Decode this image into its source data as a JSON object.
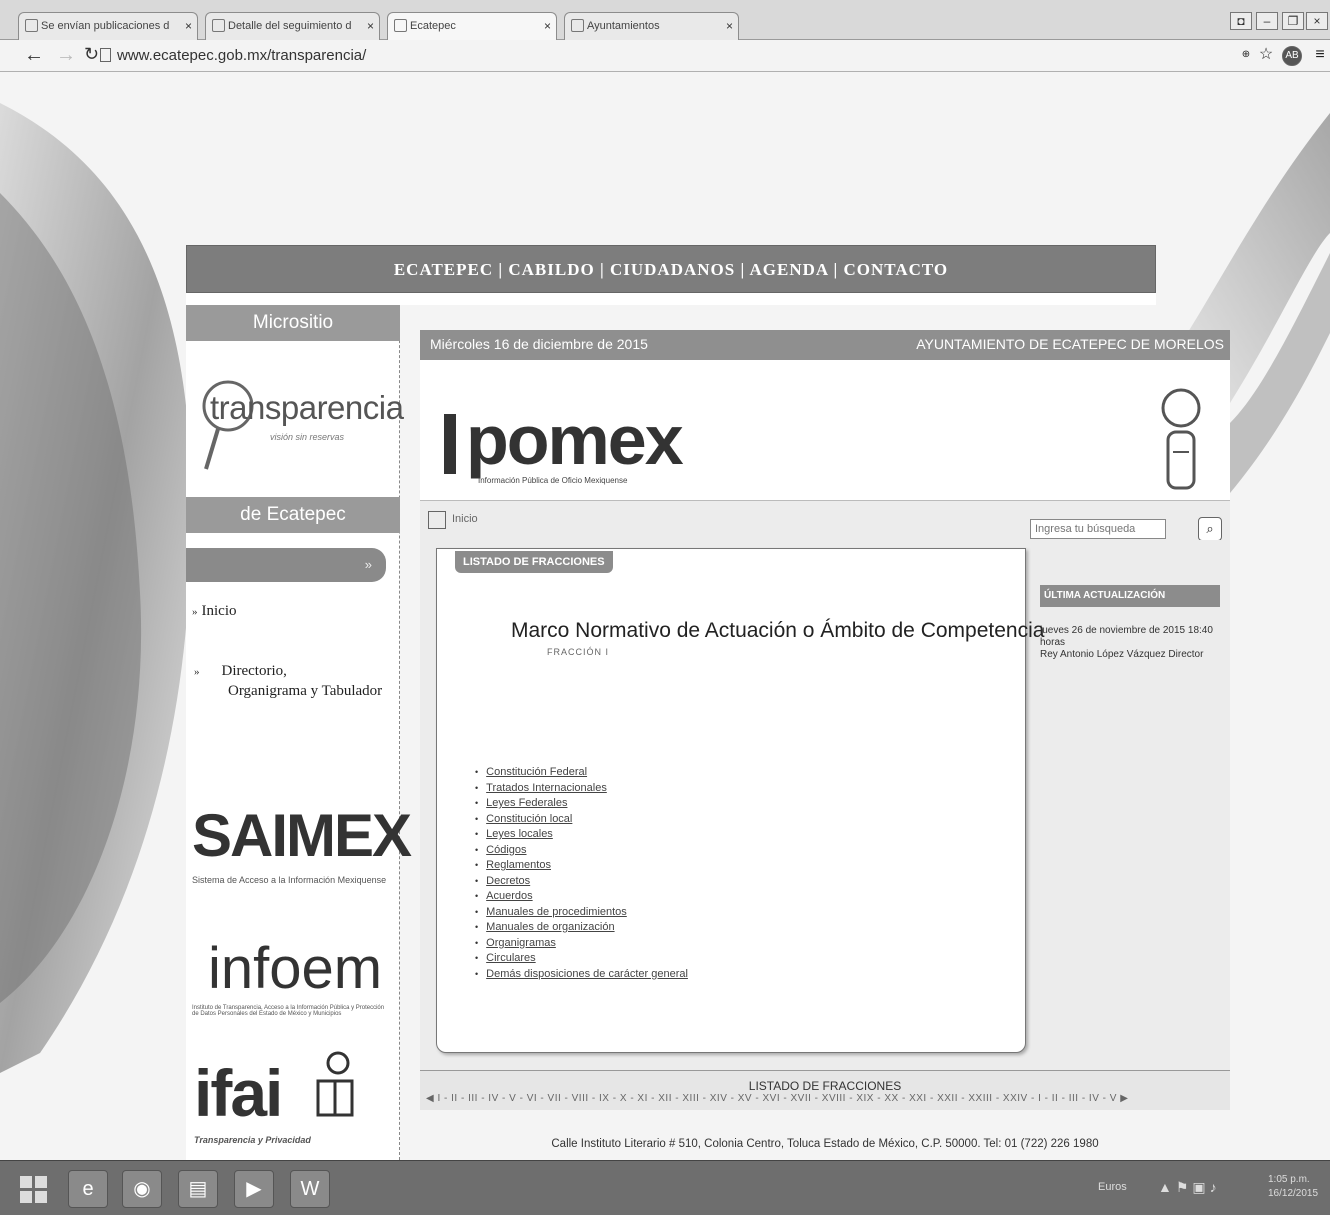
{
  "browser": {
    "tabs": [
      {
        "label": "Se envían publicaciones d",
        "active": false
      },
      {
        "label": "Detalle del seguimiento d",
        "active": false
      },
      {
        "label": "Ecatepec",
        "active": true
      },
      {
        "label": "Ayuntamientos",
        "active": false
      }
    ],
    "url": "www.ecatepec.gob.mx/transparencia/"
  },
  "site": {
    "top_nav": "ECATEPEC | CABILDO | CIUDADANOS | AGENDA | CONTACTO",
    "sidebar": {
      "title_top": "Micrositio",
      "logo_word": "transparencia",
      "logo_sub": "visión sin reservas",
      "title_bottom": "de Ecatepec",
      "menu": {
        "inicio": "Inicio",
        "directorio": "Directorio,",
        "organigrama": "Organigrama y Tabulador"
      },
      "saimex": {
        "name": "SAIMEX",
        "caption": "Sistema de Acceso a la Información Mexiquense"
      },
      "infoem": {
        "name": "infoem",
        "caption": "Instituto de Transparencia, Acceso a la Información Pública y Protección de Datos Personales del Estado de México y Municipios"
      },
      "ifai": {
        "name": "ifai",
        "caption": "Transparencia y Privacidad"
      }
    },
    "ipomex": {
      "date": "Miércoles 16 de diciembre de 2015",
      "org": "AYUNTAMIENTO DE ECATEPEC DE MORELOS",
      "logo": "pomex",
      "logo_sub": "Información Pública de Oficio Mexiquense",
      "home_label": "Inicio",
      "search_placeholder": "Ingresa tu búsqueda",
      "listado_label": "LISTADO DE FRACCIONES",
      "title": "Marco Normativo de Actuación o Ámbito de Competencia",
      "fraccion": "FRACCIÓN I",
      "documents": [
        "Constitución Federal",
        "Tratados Internacionales",
        "Leyes Federales",
        "Constitución local",
        "Leyes locales",
        "Códigos",
        "Reglamentos",
        "Decretos",
        "Acuerdos",
        "Manuales de procedimientos",
        "Manuales de organización",
        "Organigramas",
        "Circulares",
        "Demás disposiciones de carácter general"
      ],
      "update": {
        "heading": "ÚLTIMA ACTUALIZACIÓN",
        "date": "jueves 26 de noviembre de 2015 18:40 horas",
        "person": "Rey Antonio López Vázquez Director"
      },
      "fracciones_title": "LISTADO DE FRACCIONES",
      "fracciones_nav": "◀ I - II - III - IV - V - VI - VII - VIII - IX - X - XI - XII - XIII - XIV - XV - XVI - XVII - XVIII - XIX - XX - XXI - XXII - XXIII - XXIV - I - II - III - IV - V ▶",
      "footer": "Calle Instituto Literario # 510, Colonia Centro, Toluca Estado de México, C.P. 50000. Tel: 01 (722) 226 1980"
    }
  },
  "taskbar": {
    "lang": "Euros",
    "time": "1:05 p.m.",
    "date": "16/12/2015"
  }
}
